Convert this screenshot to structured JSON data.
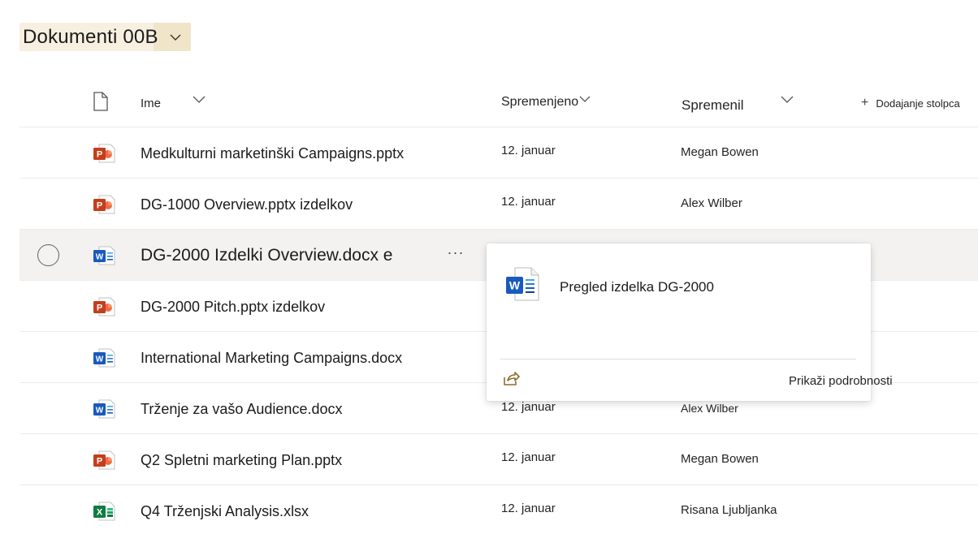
{
  "library": {
    "title": "Dokumenti 00B"
  },
  "columns": {
    "name": "Ime",
    "modified": "Spremenjeno",
    "modified_by": "Spremenil",
    "add_column": "Dodajanje stolpca"
  },
  "rows": [
    {
      "type": "pptx",
      "name": "Medkulturni marketinški Campaigns.pptx",
      "modified": "12. januar",
      "modified_by": "Megan Bowen"
    },
    {
      "type": "pptx",
      "name": "DG-1000 Overview.pptx izdelkov",
      "modified": "12. januar",
      "modified_by": "Alex Wilber"
    },
    {
      "type": "docx",
      "name": "DG-2000 Izdelki Overview.docx e",
      "modified": "",
      "modified_by": ""
    },
    {
      "type": "pptx",
      "name": "DG-2000 Pitch.pptx izdelkov",
      "modified": "",
      "modified_by": ""
    },
    {
      "type": "docx",
      "name": "International Marketing Campaigns.docx",
      "modified": "",
      "modified_by": ""
    },
    {
      "type": "docx",
      "name": "Trženje za vašo Audience.docx",
      "modified": "",
      "modified_by": ""
    },
    {
      "type": "pptx",
      "name": "Q2 Spletni marketing Plan.pptx",
      "modified": "12. januar",
      "modified_by": "Megan Bowen"
    },
    {
      "type": "xlsx",
      "name": "Q4 Trženjski Analysis.xlsx",
      "modified": "12. januar",
      "modified_by": "Risana Ljubljanka"
    }
  ],
  "row_more_label": "···",
  "popup": {
    "title": "Pregled izdelka DG-2000",
    "details_link": "Prikaži podrobnosti"
  },
  "peek_row": {
    "modified": "12. januar",
    "modified_by": "Alex Wilber"
  },
  "colors": {
    "powerpoint": "#c43e1c",
    "word": "#185abd",
    "excel": "#107c41",
    "share_icon": "#8a6d2b",
    "title_highlight": "#f0e4c9"
  }
}
